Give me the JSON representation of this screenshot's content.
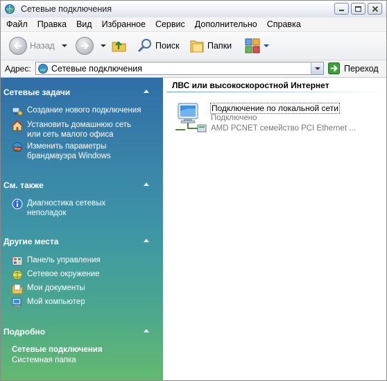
{
  "window": {
    "title": "Сетевые подключения"
  },
  "menu": [
    "Файл",
    "Правка",
    "Вид",
    "Избранное",
    "Сервис",
    "Дополнительно",
    "Справка"
  ],
  "toolbar": {
    "back_label": "Назад",
    "search_label": "Поиск",
    "folders_label": "Папки"
  },
  "address": {
    "label": "Адрес:",
    "value": "Сетевые подключения",
    "go_label": "Переход"
  },
  "taskpane": {
    "network_tasks": {
      "title": "Сетевые задачи",
      "items": [
        {
          "label": "Создание нового подключения",
          "icon": "new-connection-icon"
        },
        {
          "label": "Установить домашнюю сеть\nили сеть малого офиса",
          "icon": "home-network-icon"
        },
        {
          "label": "Изменить параметры\nбрандмауэра Windows",
          "icon": "firewall-icon"
        }
      ]
    },
    "see_also": {
      "title": "См. также",
      "items": [
        {
          "label": "Диагностика сетевых\nнеполадок",
          "icon": "info-icon"
        }
      ]
    },
    "other_places": {
      "title": "Другие места",
      "items": [
        {
          "label": "Панель управления",
          "icon": "control-panel-icon"
        },
        {
          "label": "Сетевое окружение",
          "icon": "network-places-icon"
        },
        {
          "label": "Мои документы",
          "icon": "my-documents-icon"
        },
        {
          "label": "Мой компьютер",
          "icon": "my-computer-icon"
        }
      ]
    },
    "details": {
      "title": "Подробно",
      "name": "Сетевые подключения",
      "type": "Системная папка"
    }
  },
  "content": {
    "group_title": "ЛВС или высокоскоростной Интернет",
    "connection": {
      "name": "Подключение по локальной сети",
      "status": "Подключено",
      "device": "AMD PCNET семейство PCI Ethernet ..."
    }
  },
  "colors": {
    "taskpane_top": "#2f6ea7",
    "taskpane_bottom": "#64b96f",
    "group_line": "#5ea0dc"
  }
}
